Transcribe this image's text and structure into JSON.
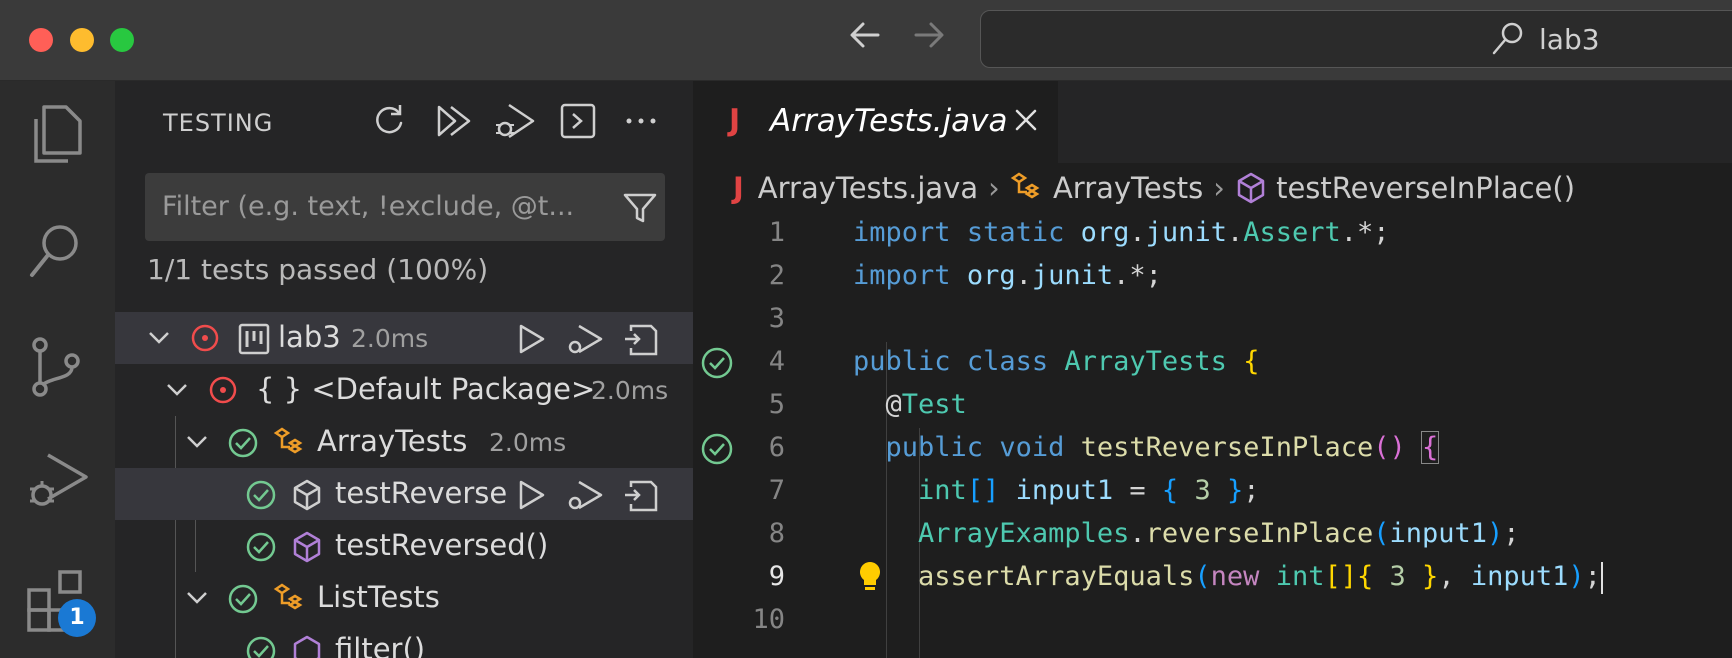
{
  "titlebar": {
    "search_text": "lab3",
    "back_icon": "arrow-left-icon",
    "forward_icon": "arrow-right-icon"
  },
  "activity_bar": {
    "items": [
      "explorer-icon",
      "search-icon",
      "source-control-icon",
      "run-debug-icon",
      "extensions-icon"
    ],
    "extensions_badge": "1"
  },
  "sidebar": {
    "title": "TESTING",
    "actions": [
      "refresh-icon",
      "run-all-icon",
      "debug-all-icon",
      "terminal-icon",
      "more-icon"
    ],
    "filter_placeholder": "Filter (e.g. text, !exclude, @t...",
    "summary": "1/1 tests passed (100%)",
    "tree": [
      {
        "label": "lab3",
        "duration": "2.0ms",
        "status": "error"
      },
      {
        "label": "{ } <Default Package>",
        "duration": "2.0ms",
        "status": "error"
      },
      {
        "label": "ArrayTests",
        "duration": "2.0ms",
        "status": "passed"
      },
      {
        "label": "testReverse",
        "duration": "",
        "status": "passed"
      },
      {
        "label": "testReversed()",
        "duration": "",
        "status": "passed"
      },
      {
        "label": "ListTests",
        "duration": "",
        "status": "passed"
      },
      {
        "label": "filter()",
        "duration": "",
        "status": "passed"
      }
    ]
  },
  "editor": {
    "tab_label": "ArrayTests.java",
    "tab_icon": "J",
    "breadcrumb": [
      "ArrayTests.java",
      "ArrayTests",
      "testReverseInPlace()"
    ],
    "line_numbers": [
      "1",
      "2",
      "3",
      "4",
      "5",
      "6",
      "7",
      "8",
      "9",
      "10"
    ],
    "current_line": "9"
  },
  "colors": {
    "accent": "#1a79d4",
    "pass": "#73c991",
    "error": "#f14c4c",
    "java": "#e04343"
  }
}
